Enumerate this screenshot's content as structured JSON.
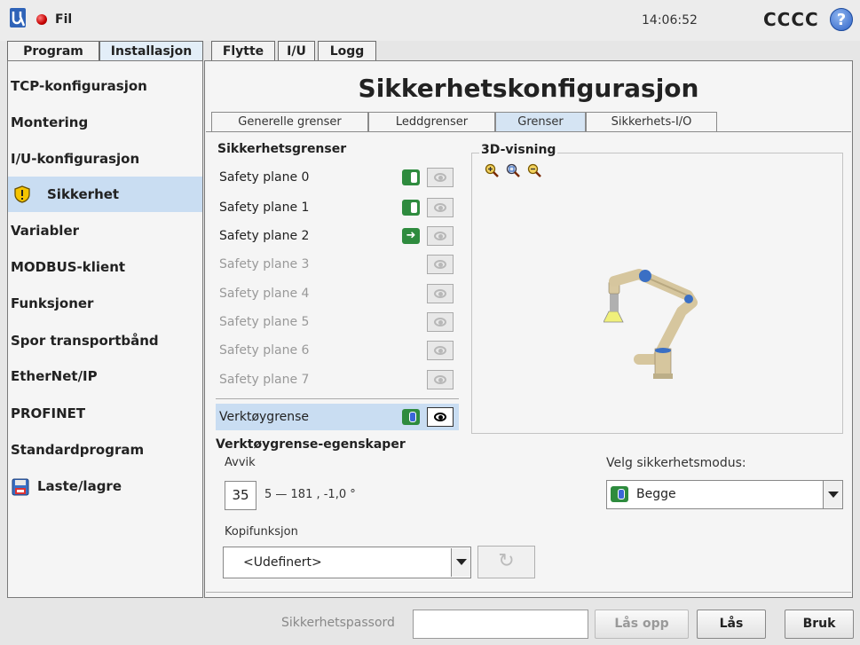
{
  "topbar": {
    "file_label": "Fil",
    "clock": "14:06:52",
    "robot_name": "CCCC",
    "help_glyph": "?"
  },
  "main_tabs": [
    "Program",
    "Installasjon",
    "Flytte",
    "I/U",
    "Logg"
  ],
  "sidebar": {
    "items": [
      "TCP-konfigurasjon",
      "Montering",
      "I/U-konfigurasjon",
      "Sikkerhet",
      "Variabler",
      "MODBUS-klient",
      "Funksjoner",
      "Spor transportbånd",
      "EtherNet/IP",
      "PROFINET",
      "Standardprogram",
      "Laste/lagre"
    ],
    "active": "Sikkerhet"
  },
  "page": {
    "title": "Sikkerhetskonfigurasjon"
  },
  "sub_tabs": [
    "Generelle grenser",
    "Leddgrenser",
    "Grenser",
    "Sikkerhets-I/O"
  ],
  "limits": {
    "heading": "Sikkerhetsgrenser",
    "planes": [
      "Safety plane 0",
      "Safety plane 1",
      "Safety plane 2",
      "Safety plane 3",
      "Safety plane 4",
      "Safety plane 5",
      "Safety plane 6",
      "Safety plane 7"
    ],
    "tool_limit": "Verktøygrense"
  },
  "view3d": {
    "title": "3D-visning",
    "zoom_icons": [
      "zoom-in-icon",
      "zoom-reset-icon",
      "zoom-out-icon"
    ]
  },
  "tool_props": {
    "heading": "Verktøygrense-egenskaper",
    "deviation_label": "Avvik",
    "deviation_value": "35",
    "deviation_range": "5 — 181 , -1,0 °",
    "copy_label": "Kopifunksjon",
    "copy_value": "<Udefinert>",
    "mode_label": "Velg sikkerhetsmodus:",
    "mode_value": "Begge"
  },
  "footer": {
    "password_label": "Sikkerhetspassord",
    "unlock": "Lås opp",
    "lock": "Lås",
    "apply": "Bruk"
  },
  "colors": {
    "accent_green": "#2e8b3e",
    "selection": "#c9ddf2",
    "panel": "#f5f5f5"
  }
}
